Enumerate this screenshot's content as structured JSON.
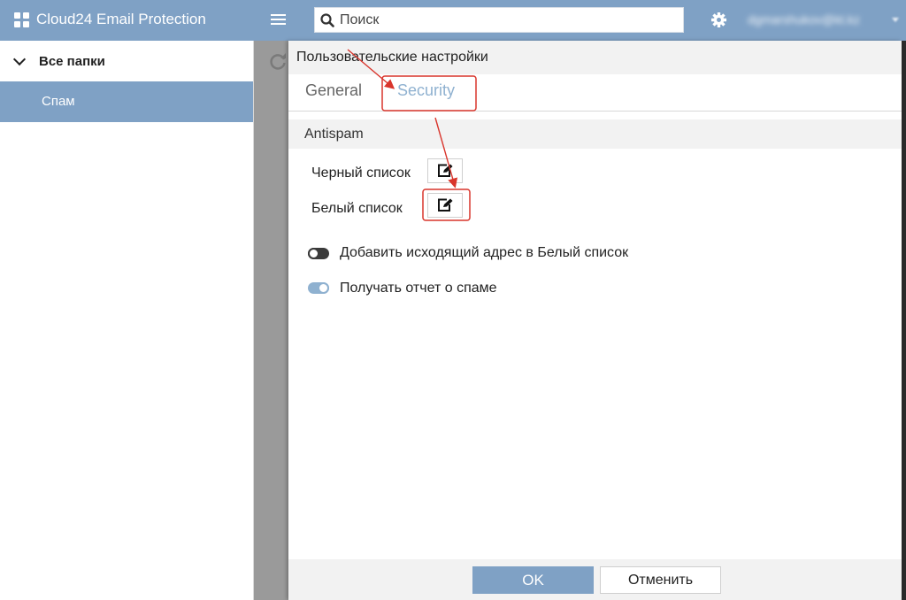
{
  "app": {
    "title": "Cloud24 Email Protection",
    "user": "dgmarshukov@kt.kz"
  },
  "search": {
    "placeholder": "Поиск"
  },
  "sidebar": {
    "items": [
      {
        "label": "Все папки"
      },
      {
        "label": "Спам"
      }
    ]
  },
  "dialog": {
    "title": "Пользовательские настройки",
    "tabs": [
      {
        "label": "General"
      },
      {
        "label": "Security"
      }
    ],
    "section_title": "Antispam",
    "blacklist_label": "Черный список",
    "whitelist_label": "Белый список",
    "toggles": [
      {
        "label": "Добавить исходящий адрес в Белый список",
        "on": false
      },
      {
        "label": "Получать отчет о спаме",
        "on": true
      }
    ],
    "ok_label": "OK",
    "cancel_label": "Отменить"
  },
  "colors": {
    "accent": "#7fa1c5",
    "tab_active": "#8fb1d0",
    "annotation": "#d9352c"
  }
}
